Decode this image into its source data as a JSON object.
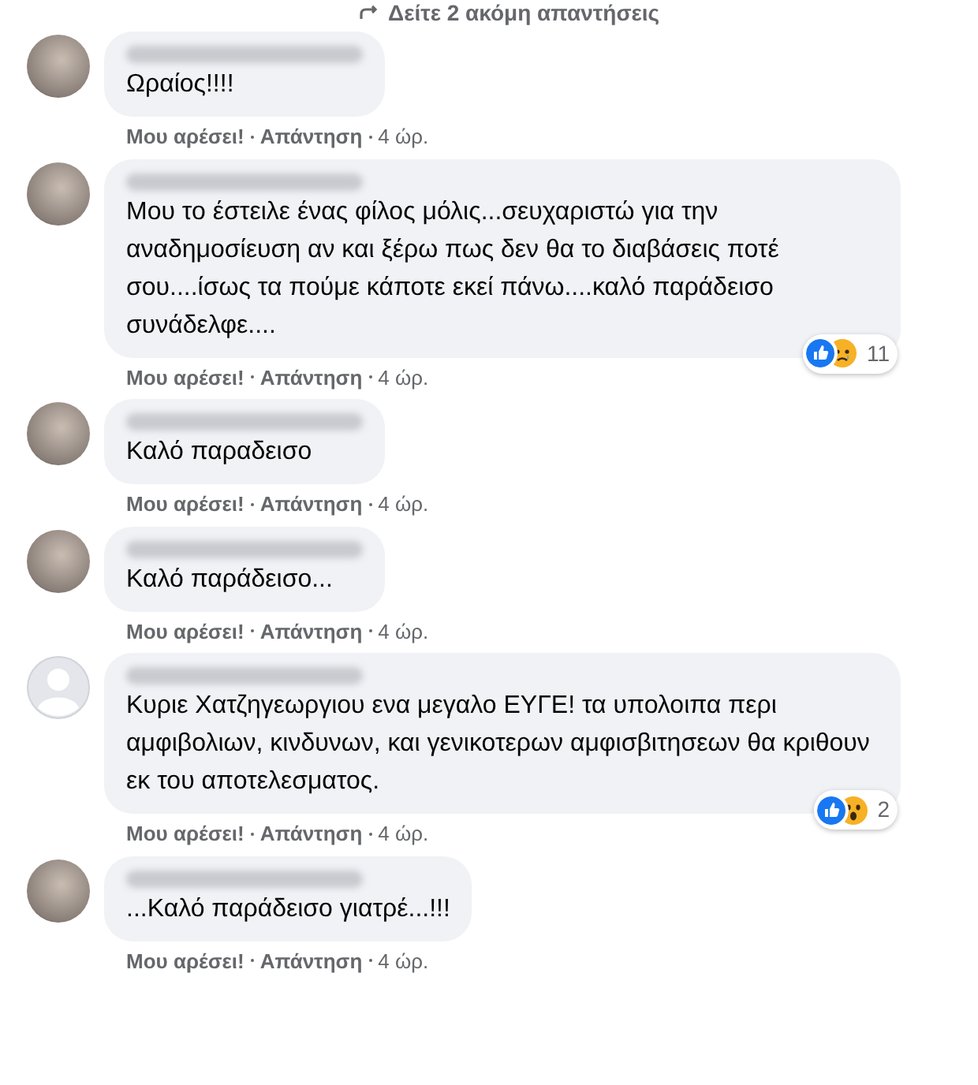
{
  "more_replies_link": "Δείτε 2 ακόμη απαντήσεις",
  "comments": [
    {
      "avatar": {
        "kind": "photo"
      },
      "text": "Ωραίος!!!!",
      "actions": {
        "like": "Μου αρέσει!",
        "reply": "Απάντηση",
        "time": "4 ώρ."
      }
    },
    {
      "avatar": {
        "kind": "photo"
      },
      "text": "Μου το έστειλε ένας φίλος μόλις...σευχαριστώ για την αναδημοσίευση αν και ξέρω πως δεν θα το διαβάσεις ποτέ σου....ίσως τα πούμε κάποτε εκεί πάνω....καλό παράδεισο συνάδελφε....",
      "actions": {
        "like": "Μου αρέσει!",
        "reply": "Απάντηση",
        "time": "4 ώρ."
      },
      "reactions": {
        "icons": [
          {
            "kind": "like"
          },
          {
            "kind": "sad"
          }
        ],
        "count": "11"
      }
    },
    {
      "avatar": {
        "kind": "photo"
      },
      "text": "Καλό παραδεισο",
      "actions": {
        "like": "Μου αρέσει!",
        "reply": "Απάντηση",
        "time": "4 ώρ."
      }
    },
    {
      "avatar": {
        "kind": "photo"
      },
      "text": "Καλό παράδεισο...",
      "actions": {
        "like": "Μου αρέσει!",
        "reply": "Απάντηση",
        "time": "4 ώρ."
      }
    },
    {
      "avatar": {
        "kind": "default"
      },
      "text": "Κυριε Χατζηγεωργιου ενα μεγαλο ΕΥΓΕ! τα υπολοιπα περι αμφιβολιων, κινδυνων, και γενικοτερων αμφισβιτησεων θα κριθουν εκ του αποτελεσματος.",
      "actions": {
        "like": "Μου αρέσει!",
        "reply": "Απάντηση",
        "time": "4 ώρ."
      },
      "reactions": {
        "icons": [
          {
            "kind": "like"
          },
          {
            "kind": "wow"
          }
        ],
        "count": "2"
      }
    },
    {
      "avatar": {
        "kind": "photo"
      },
      "text": "...Καλό παράδεισο γιατρέ...!!!",
      "actions": {
        "like": "Μου αρέσει!",
        "reply": "Απάντηση",
        "time": "4 ώρ."
      }
    }
  ]
}
